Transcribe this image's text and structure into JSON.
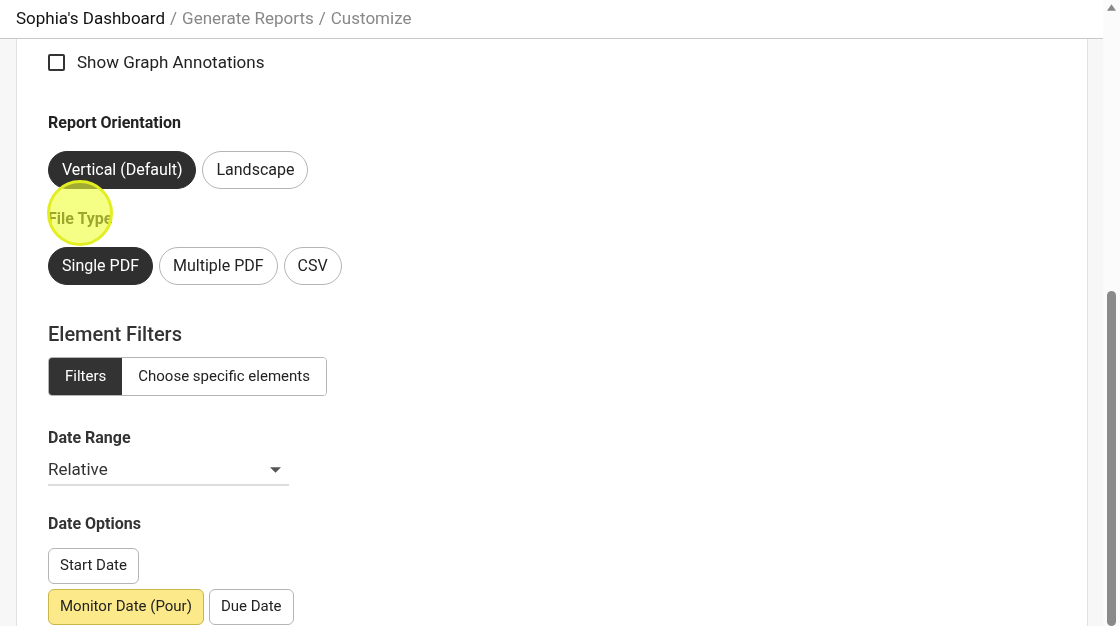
{
  "breadcrumb": {
    "separator": "/",
    "items": [
      "Sophia's Dashboard",
      "Generate Reports",
      "Customize"
    ]
  },
  "annotations": {
    "label": "Show Graph Annotations",
    "checked": false
  },
  "orientation": {
    "title": "Report Orientation",
    "options": [
      {
        "label": "Vertical (Default)",
        "selected": true
      },
      {
        "label": "Landscape",
        "selected": false
      }
    ]
  },
  "file_type": {
    "title": "File Type",
    "options": [
      {
        "label": "Single PDF",
        "selected": true
      },
      {
        "label": "Multiple PDF",
        "selected": false
      },
      {
        "label": "CSV",
        "selected": false
      }
    ]
  },
  "element_filters": {
    "title": "Element Filters",
    "options": [
      {
        "label": "Filters",
        "selected": true
      },
      {
        "label": "Choose specific elements",
        "selected": false
      }
    ]
  },
  "date_range": {
    "title": "Date Range",
    "value": "Relative"
  },
  "date_options": {
    "title": "Date Options",
    "rows": [
      [
        {
          "label": "Start Date",
          "selected": false
        }
      ],
      [
        {
          "label": "Monitor Date (Pour)",
          "selected": true
        },
        {
          "label": "Due Date",
          "selected": false
        }
      ]
    ]
  }
}
